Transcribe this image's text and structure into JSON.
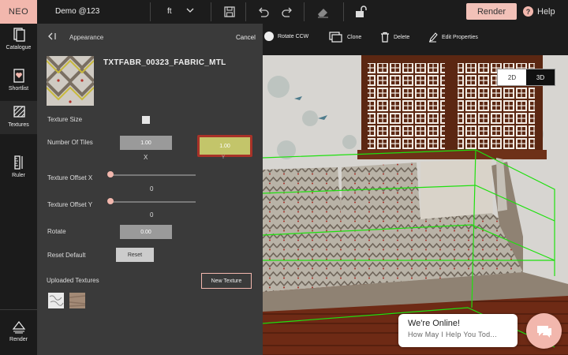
{
  "topbar": {
    "logo": "NEO",
    "project_name": "Demo @123",
    "unit": "ft",
    "render_label": "Render",
    "help_label": "Help"
  },
  "sidebar": {
    "items": [
      {
        "label": "Catalogue",
        "icon": "catalogue-icon"
      },
      {
        "label": "Shortlist",
        "icon": "heart-doc-icon"
      },
      {
        "label": "Textures",
        "icon": "textures-icon"
      },
      {
        "label": "Ruler",
        "icon": "ruler-icon"
      },
      {
        "label": "Render",
        "icon": "render-icon"
      }
    ]
  },
  "panel": {
    "title": "Appearance",
    "cancel_label": "Cancel",
    "material_name": "TXTFABR_00323_FABRIC_MTL",
    "texture_size_label": "Texture Size",
    "tiles_label": "Number Of Tiles",
    "tiles_x_value": "1.00",
    "tiles_y_value": "1.00",
    "x_label": "X",
    "y_label": "Y",
    "offset_x_label": "Texture Offset X",
    "offset_x_value": "0",
    "offset_y_label": "Texture Offset Y",
    "offset_y_value": "0",
    "rotate_label": "Rotate",
    "rotate_value": "0.00",
    "reset_default_label": "Reset Default",
    "reset_button": "Reset",
    "uploaded_label": "Uploaded Textures",
    "new_texture_button": "New Texture"
  },
  "viewport": {
    "tools": [
      {
        "label": "Rotate CCW",
        "icon": "rotate-ccw-icon"
      },
      {
        "label": "Clone",
        "icon": "clone-icon"
      },
      {
        "label": "Delete",
        "icon": "trash-icon"
      },
      {
        "label": "Edit Properties",
        "icon": "pencil-icon"
      }
    ],
    "view_2d": "2D",
    "view_3d": "3D"
  },
  "chat": {
    "title": "We're Online!",
    "subtitle": "How May I Help You Tod..."
  },
  "colors": {
    "accent": "#f2b7ad",
    "active_field": "#c3c56a",
    "active_border": "#a83228"
  }
}
